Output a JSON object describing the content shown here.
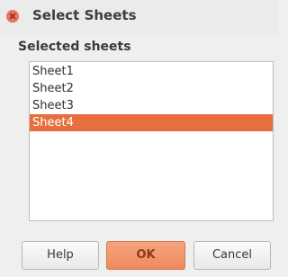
{
  "window": {
    "title": "Select Sheets"
  },
  "section": {
    "label": "Selected sheets"
  },
  "sheets": {
    "items": [
      {
        "label": "Sheet1",
        "selected": false
      },
      {
        "label": "Sheet2",
        "selected": false
      },
      {
        "label": "Sheet3",
        "selected": false
      },
      {
        "label": "Sheet4",
        "selected": true
      }
    ]
  },
  "buttons": {
    "help": "Help",
    "ok": "OK",
    "cancel": "Cancel"
  },
  "colors": {
    "accent": "#e76f3e",
    "close": "#ef7466"
  }
}
